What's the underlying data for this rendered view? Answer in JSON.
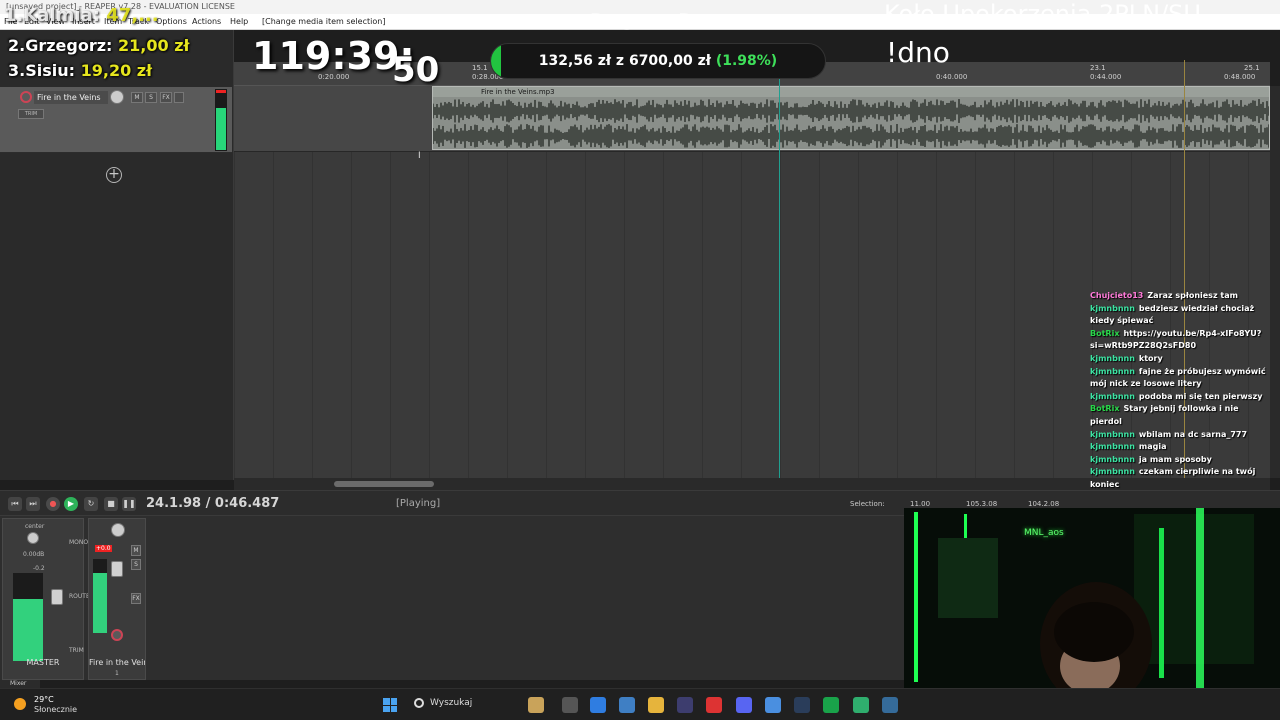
{
  "window": {
    "title": "[unsaved project] - REAPER v7.28 - EVALUATION LICENSE"
  },
  "menu": {
    "items": [
      "File",
      "Edit",
      "View",
      "Insert",
      "Item",
      "Track",
      "Options",
      "Actions",
      "Help"
    ],
    "context": "[Change media item selection]"
  },
  "ruler": {
    "marks": [
      "15.1",
      "0:28.000",
      "0:40.000",
      "23.1",
      "0:44.000",
      "25.1",
      "0:48.000",
      "0:20.000"
    ]
  },
  "track": {
    "name": "Fire in the Veins",
    "io_label": "TRIM",
    "mute": "M",
    "solo": "S",
    "fx": "FX"
  },
  "media_item": {
    "name": "Fire in the Veins.mp3"
  },
  "transport": {
    "time": "24.1.98 / 0:46.487",
    "status": "[Playing]"
  },
  "selection": {
    "label": "Selection:",
    "start": "11.00",
    "end": "105.3.08",
    "length": "104.2.08"
  },
  "mixer": {
    "master": {
      "name": "MASTER",
      "pan": "center",
      "vol": "0.00dB",
      "peak": "-0.2",
      "mono": "MONO",
      "route": "ROUTE",
      "trim": "TRIM"
    },
    "track": {
      "name": "Fire in the Veins",
      "peak": "+0.0",
      "number": "1"
    },
    "tab": "Mixer"
  },
  "taskbar": {
    "temperature": "29°C",
    "weather": "Słonecznie",
    "search": "Wyszukaj"
  },
  "overlay": {
    "leader2": {
      "label": "2.Grzegorz:",
      "amount": "21,00 zł"
    },
    "leader3": {
      "label": "3.Sisiu:",
      "amount": "19,20 zł"
    },
    "leader1": {
      "label": "1.Kalmia:",
      "amount": "47,..."
    },
    "countdown_main": "119:39:",
    "countdown_sec": "50",
    "goal": {
      "current": "132,56 zł",
      "sep": "z",
      "target": "6700,00 zł",
      "percent": "(1.98%)",
      "progress": 0.0198
    },
    "title": "Droga na Dno",
    "scroll": "Koło Upokorzenia 2PLN/SU",
    "command": "!dno",
    "webcam_label": "MNL_aos"
  },
  "chat": [
    {
      "user": "Chujcieto13",
      "color": "#ff7ad9",
      "text": "Zaraz spłoniesz tam"
    },
    {
      "user": "kjmnbnnn",
      "color": "#3de3a3",
      "text": "bedziesz wiedział chociaż kiedy śpiewać"
    },
    {
      "user": "BotRix",
      "color": "#29d64a",
      "text": "https://youtu.be/Rp4-xIFo8YU?si=wRtb9PZ28Q2sFD80"
    },
    {
      "user": "kjmnbnnn",
      "color": "#3de3a3",
      "text": "ktory"
    },
    {
      "user": "kjmnbnnn",
      "color": "#3de3a3",
      "text": "fajne że próbujesz wymówić mój nick ze losowe litery"
    },
    {
      "user": "kjmnbnnn",
      "color": "#3de3a3",
      "text": "podoba mi się ten pierwszy"
    },
    {
      "user": "BotRix",
      "color": "#29d64a",
      "text": "Stary jebnij followka i nie pierdol"
    },
    {
      "user": "kjmnbnnn",
      "color": "#3de3a3",
      "text": "wbilam na dc sarna_777"
    },
    {
      "user": "kjmnbnnn",
      "color": "#3de3a3",
      "text": "magia"
    },
    {
      "user": "kjmnbnnn",
      "color": "#3de3a3",
      "text": "ja mam sposoby"
    },
    {
      "user": "kjmnbnnn",
      "color": "#3de3a3",
      "text": "czekam cierpliwie na twój koniec"
    }
  ],
  "colors": {
    "accent_green": "#2eb35a",
    "meter_green": "#32d17d",
    "goal_green": "#22c440",
    "gold": "#e6e61e"
  }
}
